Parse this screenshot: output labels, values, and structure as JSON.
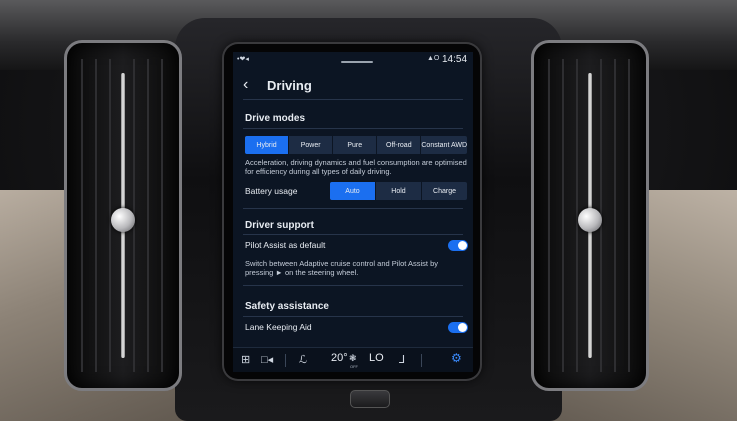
{
  "status": {
    "signal": "•❤◂",
    "indicator": "▲O",
    "time": "14:54"
  },
  "header": {
    "title": "Driving"
  },
  "drive_modes": {
    "title": "Drive modes",
    "options": [
      "Hybrid",
      "Power",
      "Pure",
      "Off-road",
      "Constant AWD"
    ],
    "selected": "Hybrid",
    "description": "Acceleration, driving dynamics and fuel consumption are optimised for efficiency during all types of daily driving."
  },
  "battery_usage": {
    "label": "Battery usage",
    "options": [
      "Auto",
      "Hold",
      "Charge"
    ],
    "selected": "Auto"
  },
  "driver_support": {
    "title": "Driver support",
    "pilot_assist_label": "Pilot Assist as default",
    "pilot_assist_on": true,
    "description": "Switch between Adaptive cruise control and Pilot Assist by pressing ► on the steering wheel."
  },
  "safety_assistance": {
    "title": "Safety assistance",
    "lane_keeping_label": "Lane Keeping Aid",
    "lane_keeping_on": true
  },
  "dock": {
    "temperature": "20°",
    "fan_label": "OFF",
    "climate_level": "LO"
  },
  "colors": {
    "accent": "#1b6ff0",
    "screen_bg": "#0c1523"
  }
}
